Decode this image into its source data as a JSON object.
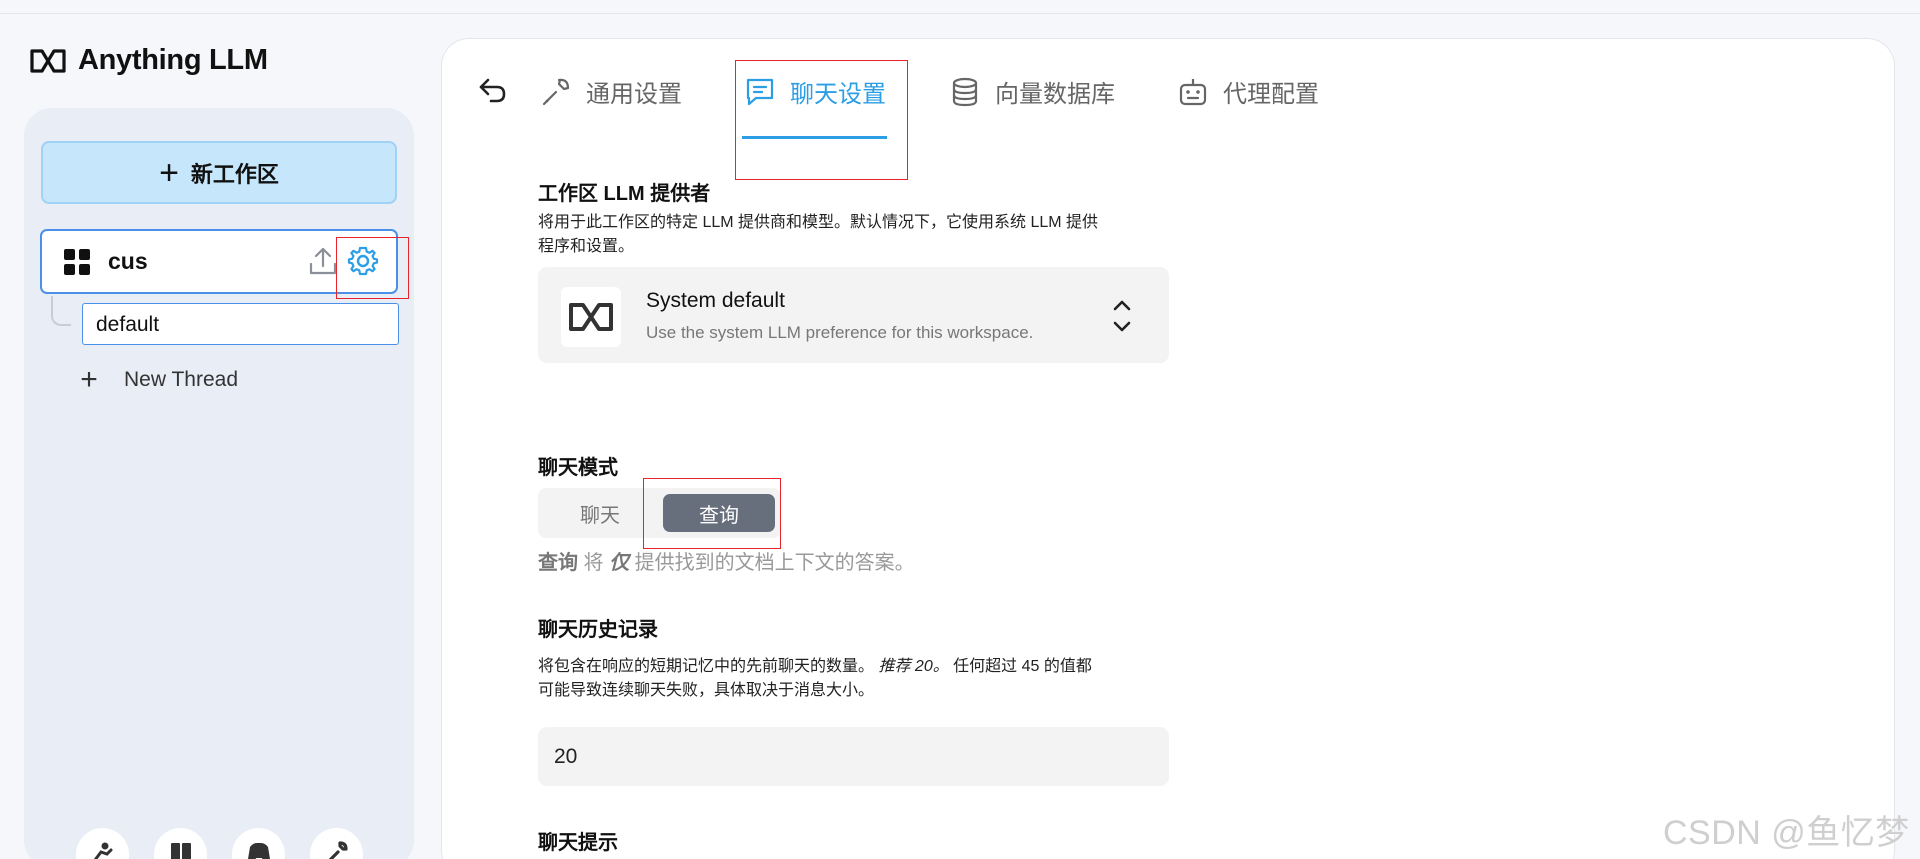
{
  "app": {
    "title": "Anything LLM"
  },
  "sidebar": {
    "new_workspace_label": "新工作区",
    "workspace": {
      "name": "cus"
    },
    "threads": [
      {
        "label": "default"
      }
    ],
    "new_thread_label": "New Thread",
    "footer_icons": [
      "community-icon",
      "docs-icon",
      "discord-icon",
      "settings-wrench-icon"
    ]
  },
  "tabs": [
    {
      "label": "通用设置",
      "icon": "wrench-icon",
      "active": false
    },
    {
      "label": "聊天设置",
      "icon": "chat-icon",
      "active": true
    },
    {
      "label": "向量数据库",
      "icon": "database-icon",
      "active": false
    },
    {
      "label": "代理配置",
      "icon": "robot-icon",
      "active": false
    }
  ],
  "settings": {
    "llm_provider": {
      "title": "工作区 LLM 提供者",
      "description_line1": "将用于此工作区的特定 LLM 提供商和模型。默认情况下，它使用系统 LLM 提供",
      "description_line2": "程序和设置。",
      "selected_name": "System default",
      "selected_desc": "Use the system LLM preference for this workspace."
    },
    "chat_mode": {
      "title": "聊天模式",
      "options": [
        "聊天",
        "查询"
      ],
      "selected": "查询",
      "desc_strong": "查询",
      "desc_mid": " 将 ",
      "desc_em": "仅",
      "desc_rest": " 提供找到的文档上下文的答案。"
    },
    "chat_history": {
      "title": "聊天历史记录",
      "desc_line1_a": "将包含在响应的短期记忆中的先前聊天的数量。",
      "desc_line1_em": "推荐 20。",
      "desc_line1_b": " 任何超过 45 的值都",
      "desc_line2": "可能导致连续聊天失败，具体取决于消息大小。",
      "value": "20"
    },
    "chat_prompt": {
      "title": "聊天提示"
    }
  },
  "watermark": "CSDN @鱼忆梦",
  "colors": {
    "accent": "#2b9ee6",
    "highlight_box": "#e8232a",
    "toggle_selected": "#676f7c"
  }
}
